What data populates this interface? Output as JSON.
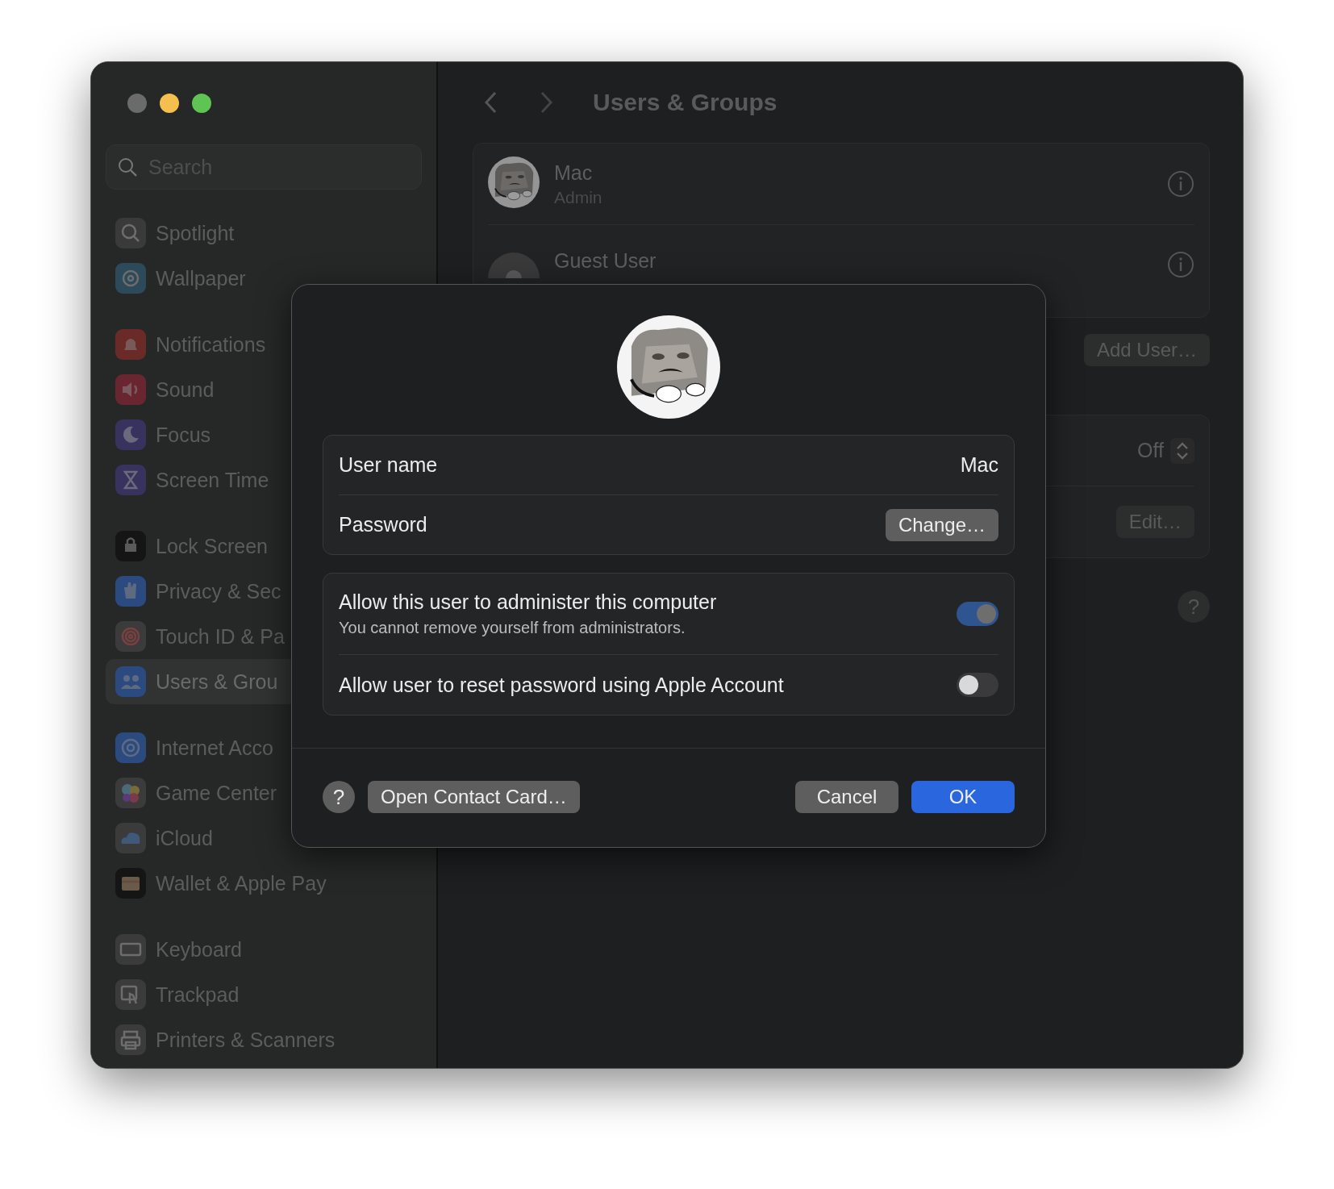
{
  "sidebar": {
    "search": {
      "placeholder": "Search"
    },
    "groups": [
      [
        {
          "label": "Spotlight",
          "selected": false
        },
        {
          "label": "Wallpaper",
          "selected": false
        }
      ],
      [
        {
          "label": "Notifications",
          "selected": false
        },
        {
          "label": "Sound",
          "selected": false
        },
        {
          "label": "Focus",
          "selected": false
        },
        {
          "label": "Screen Time",
          "selected": false
        }
      ],
      [
        {
          "label": "Lock Screen",
          "selected": false
        },
        {
          "label": "Privacy & Sec",
          "selected": false
        },
        {
          "label": "Touch ID & Pa",
          "selected": false
        },
        {
          "label": "Users & Grou",
          "selected": true
        }
      ],
      [
        {
          "label": "Internet Acco",
          "selected": false
        },
        {
          "label": "Game Center",
          "selected": false
        },
        {
          "label": "iCloud",
          "selected": false
        },
        {
          "label": "Wallet & Apple Pay",
          "selected": false
        }
      ],
      [
        {
          "label": "Keyboard",
          "selected": false
        },
        {
          "label": "Trackpad",
          "selected": false
        },
        {
          "label": "Printers & Scanners",
          "selected": false
        }
      ]
    ]
  },
  "header": {
    "title": "Users & Groups"
  },
  "users": [
    {
      "kind": "picture",
      "name": "Mac",
      "role": "Admin"
    },
    {
      "kind": "guest",
      "name": "Guest User"
    }
  ],
  "add_user_button": "Add User…",
  "settings_card": {
    "value": "Off",
    "edit_button": "Edit…"
  },
  "help_button": "?",
  "dialog": {
    "user_name": {
      "label": "User name",
      "value": "Mac"
    },
    "password": {
      "label": "Password",
      "button": "Change…"
    },
    "toggles": [
      {
        "label": "Allow this user to administer this computer",
        "note": "You cannot remove yourself from administrators.",
        "on": true
      },
      {
        "label": "Allow user to reset password using Apple Account",
        "on": false
      }
    ],
    "help_button": "?",
    "contact_button": "Open Contact Card…",
    "cancel_button": "Cancel",
    "ok_button": "OK"
  }
}
